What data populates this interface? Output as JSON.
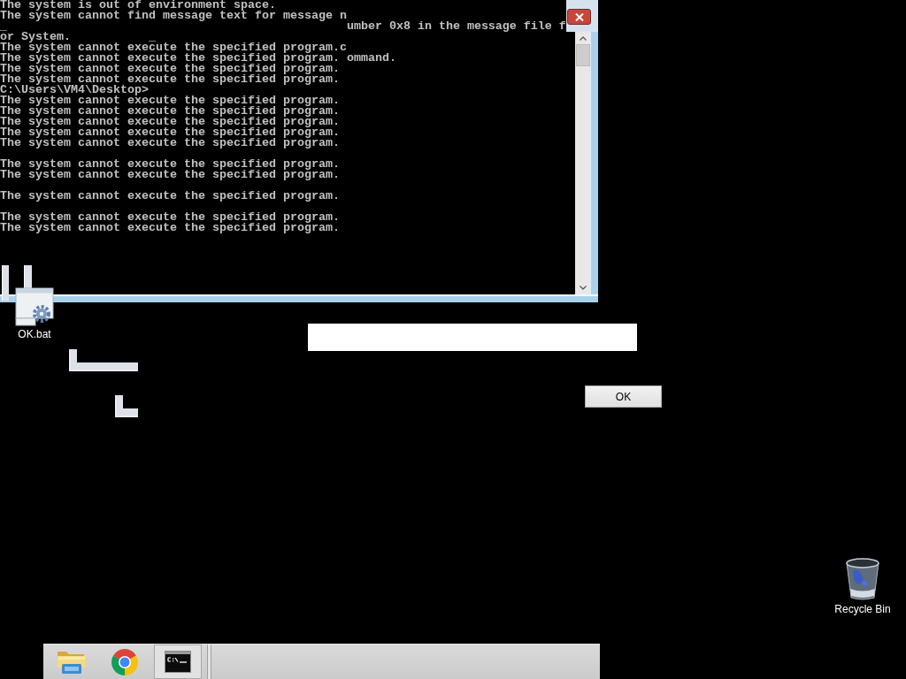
{
  "console": {
    "blocks": [
      [
        "The system is out of environment space.",
        "The system cannot find message text for message n",
        "_                                                umber 0x8 in the message file f",
        "or System.           _",
        "The system cannot execute the specified program.c",
        "The system cannot execute the specified program. ommand.",
        "The system cannot execute the specified program.",
        "The system cannot execute the specified program.",
        "C:\\Users\\VM4\\Desktop>",
        "The system cannot execute the specified program.",
        "The system cannot execute the specified program.",
        "The system cannot execute the specified program.",
        "The system cannot execute the specified program.",
        "The system cannot execute the specified program."
      ],
      [
        "The system cannot execute the specified program.",
        "The system cannot execute the specified program."
      ],
      [
        "The system cannot execute the specified program."
      ],
      [
        "The system cannot execute the specified program.",
        "The system cannot execute the specified program."
      ]
    ]
  },
  "desktop_icons": [
    {
      "kind": "batch-file",
      "label": "OK.bat"
    },
    {
      "kind": "recycle-bin",
      "label": "Recycle Bin"
    }
  ],
  "dialog": {
    "button": "OK"
  },
  "taskbar": {
    "items": [
      {
        "kind": "folder",
        "selected": false
      },
      {
        "kind": "browser",
        "selected": false
      },
      {
        "kind": "console",
        "selected": true
      }
    ]
  }
}
